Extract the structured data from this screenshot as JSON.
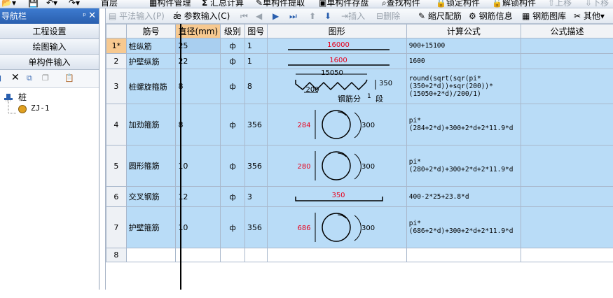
{
  "menu": {
    "floor": "首层",
    "build_manage": "构件管理",
    "summary_calc": "汇总计算",
    "single_extract": "单构件提取",
    "single_save": "单构件存盘",
    "find_component": "查找构件",
    "lock_component": "锁定构件",
    "unlock_component": "解锁构件",
    "move_up": "上移",
    "move_down": "下移"
  },
  "left": {
    "title": "导航栏",
    "pin": "ᵖ",
    "sections": [
      "工程设置",
      "绘图输入",
      "单构件输入"
    ],
    "tree": {
      "root": "桩",
      "child": "ZJ-1"
    }
  },
  "toolbar": {
    "flat_input": "平法输入(P)",
    "param_input": "参数输入(C)",
    "insert": "插入",
    "delete": "删除",
    "scale_config": "缩尺配筋",
    "rebar_info": "钢筋信息",
    "rebar_lib": "钢筋图库",
    "other": "其他"
  },
  "table": {
    "headers": [
      "筋号",
      "直径(mm)",
      "级别",
      "图号",
      "图形",
      "计算公式",
      "公式描述"
    ],
    "rows": [
      {
        "num": "1*",
        "name": "桩纵筋",
        "dia": "25",
        "grade": "ф",
        "fig": "1",
        "formula": "900+15100",
        "desc": "",
        "shape": "line",
        "val": "16000"
      },
      {
        "num": "2",
        "name": "护壁纵筋",
        "dia": "22",
        "grade": "ф",
        "fig": "1",
        "formula": "1600",
        "desc": "",
        "shape": "line",
        "val": "1600"
      },
      {
        "num": "3",
        "name": "桩螺旋箍筋",
        "dia": "8",
        "grade": "ф",
        "fig": "8",
        "formula": "round(sqrt(sqr(pi*(350+2*d))+sqr(200))*(15050+2*d)/200/1)",
        "desc": "",
        "shape": "spiral",
        "len": "15050",
        "pitch": "200",
        "dia_v": "350",
        "seg_a": "钢筋分",
        "seg_n": "1",
        "seg_b": "段"
      },
      {
        "num": "4",
        "name": "加劲箍筋",
        "dia": "8",
        "grade": "ф",
        "fig": "356",
        "formula": "pi*(284+2*d)+300+2*d+2*11.9*d",
        "desc": "",
        "shape": "circle",
        "cv": "284",
        "lap": "300"
      },
      {
        "num": "5",
        "name": "圆形箍筋",
        "dia": "10",
        "grade": "ф",
        "fig": "356",
        "formula": "pi*(280+2*d)+300+2*d+2*11.9*d",
        "desc": "",
        "shape": "circle",
        "cv": "280",
        "lap": "300"
      },
      {
        "num": "6",
        "name": "交叉钢筋",
        "dia": "12",
        "grade": "ф",
        "fig": "3",
        "formula": "400-2*25+23.8*d",
        "desc": "",
        "shape": "hook",
        "val": "350"
      },
      {
        "num": "7",
        "name": "护壁箍筋",
        "dia": "10",
        "grade": "ф",
        "fig": "356",
        "formula": "pi*(686+2*d)+300+2*d+2*11.9*d",
        "desc": "",
        "shape": "circle",
        "cv": "686",
        "lap": "300"
      },
      {
        "num": "8",
        "name": "",
        "dia": "",
        "grade": "",
        "fig": "",
        "formula": "",
        "desc": "",
        "shape": "none"
      }
    ]
  },
  "colors": {
    "selected_header": "#f7c990",
    "row_bg": "#b9dcf7",
    "red_text": "#e8001c",
    "nav_title": "#2a5fae"
  }
}
